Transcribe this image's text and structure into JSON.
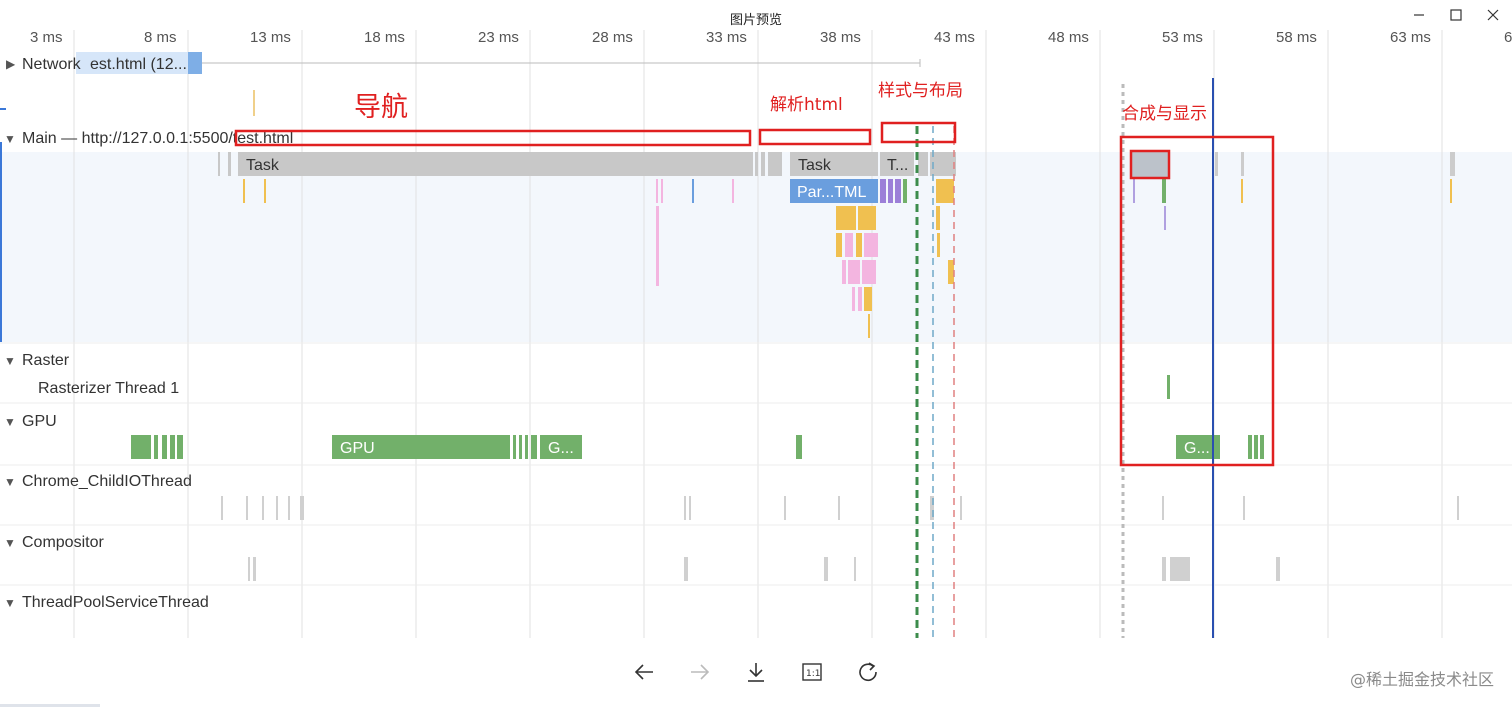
{
  "window": {
    "title": "图片预览"
  },
  "ruler": {
    "ticks": [
      "3 ms",
      "8 ms",
      "13 ms",
      "18 ms",
      "23 ms",
      "28 ms",
      "33 ms",
      "38 ms",
      "43 ms",
      "48 ms",
      "53 ms",
      "58 ms",
      "63 ms",
      "6"
    ]
  },
  "tracks": {
    "network": "Network",
    "network_item": "est.html (12...",
    "main": "Main — http://127.0.0.1:5500/test.html",
    "raster": "Raster",
    "rasterizer": "Rasterizer Thread 1",
    "gpu": "GPU",
    "childio": "Chrome_ChildIOThread",
    "compositor": "Compositor",
    "threadpool": "ThreadPoolServiceThread"
  },
  "events": {
    "task1": "Task",
    "task2": "Task",
    "task3": "T...",
    "parse": "Par...TML",
    "gpu1": "GPU",
    "gpu2": "G...",
    "gpu3": "G..."
  },
  "annotations": {
    "nav": "导航",
    "parse_html": "解析html",
    "style_layout": "样式与布局",
    "composite": "合成与显示"
  },
  "watermark": "@稀土掘金技术社区",
  "colors": {
    "annotation": "#e02020",
    "task": "#c8c8c8",
    "parse": "#6a9ede",
    "gpu": "#72b06a",
    "marker": "#2a4fb0"
  }
}
